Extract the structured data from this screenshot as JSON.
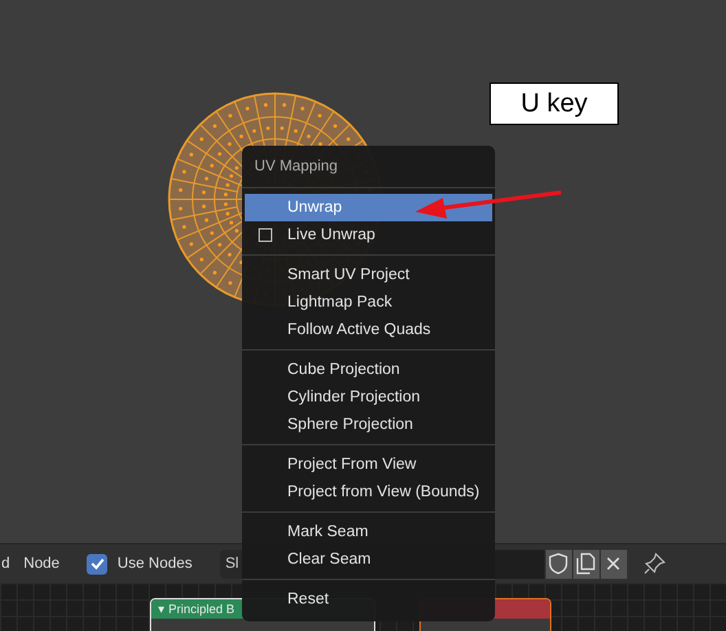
{
  "viewport": {
    "annotation": "U key"
  },
  "menu": {
    "title": "UV Mapping",
    "groups": [
      [
        {
          "label": "Unwrap",
          "kind": "item",
          "selected": true
        },
        {
          "label": "Live Unwrap",
          "kind": "checkbox",
          "checked": false,
          "selected": false
        }
      ],
      [
        {
          "label": "Smart UV Project",
          "kind": "item",
          "selected": false
        },
        {
          "label": "Lightmap Pack",
          "kind": "item",
          "selected": false
        },
        {
          "label": "Follow Active Quads",
          "kind": "item",
          "selected": false
        }
      ],
      [
        {
          "label": "Cube Projection",
          "kind": "item",
          "selected": false
        },
        {
          "label": "Cylinder Projection",
          "kind": "item",
          "selected": false
        },
        {
          "label": "Sphere Projection",
          "kind": "item",
          "selected": false
        }
      ],
      [
        {
          "label": "Project From View",
          "kind": "item",
          "selected": false
        },
        {
          "label": "Project from View (Bounds)",
          "kind": "item",
          "selected": false
        }
      ],
      [
        {
          "label": "Mark Seam",
          "kind": "item",
          "selected": false
        },
        {
          "label": "Clear Seam",
          "kind": "item",
          "selected": false
        }
      ],
      [
        {
          "label": "Reset",
          "kind": "item",
          "selected": false
        }
      ]
    ]
  },
  "header": {
    "cut_label": "d",
    "node_menu": "Node",
    "use_nodes": {
      "label": "Use Nodes",
      "checked": true
    },
    "slot_field": "Sl"
  },
  "nodes": [
    {
      "title": "▾ Principled B",
      "color": "#2b8a57"
    },
    {
      "color": "#a8343c"
    }
  ]
}
